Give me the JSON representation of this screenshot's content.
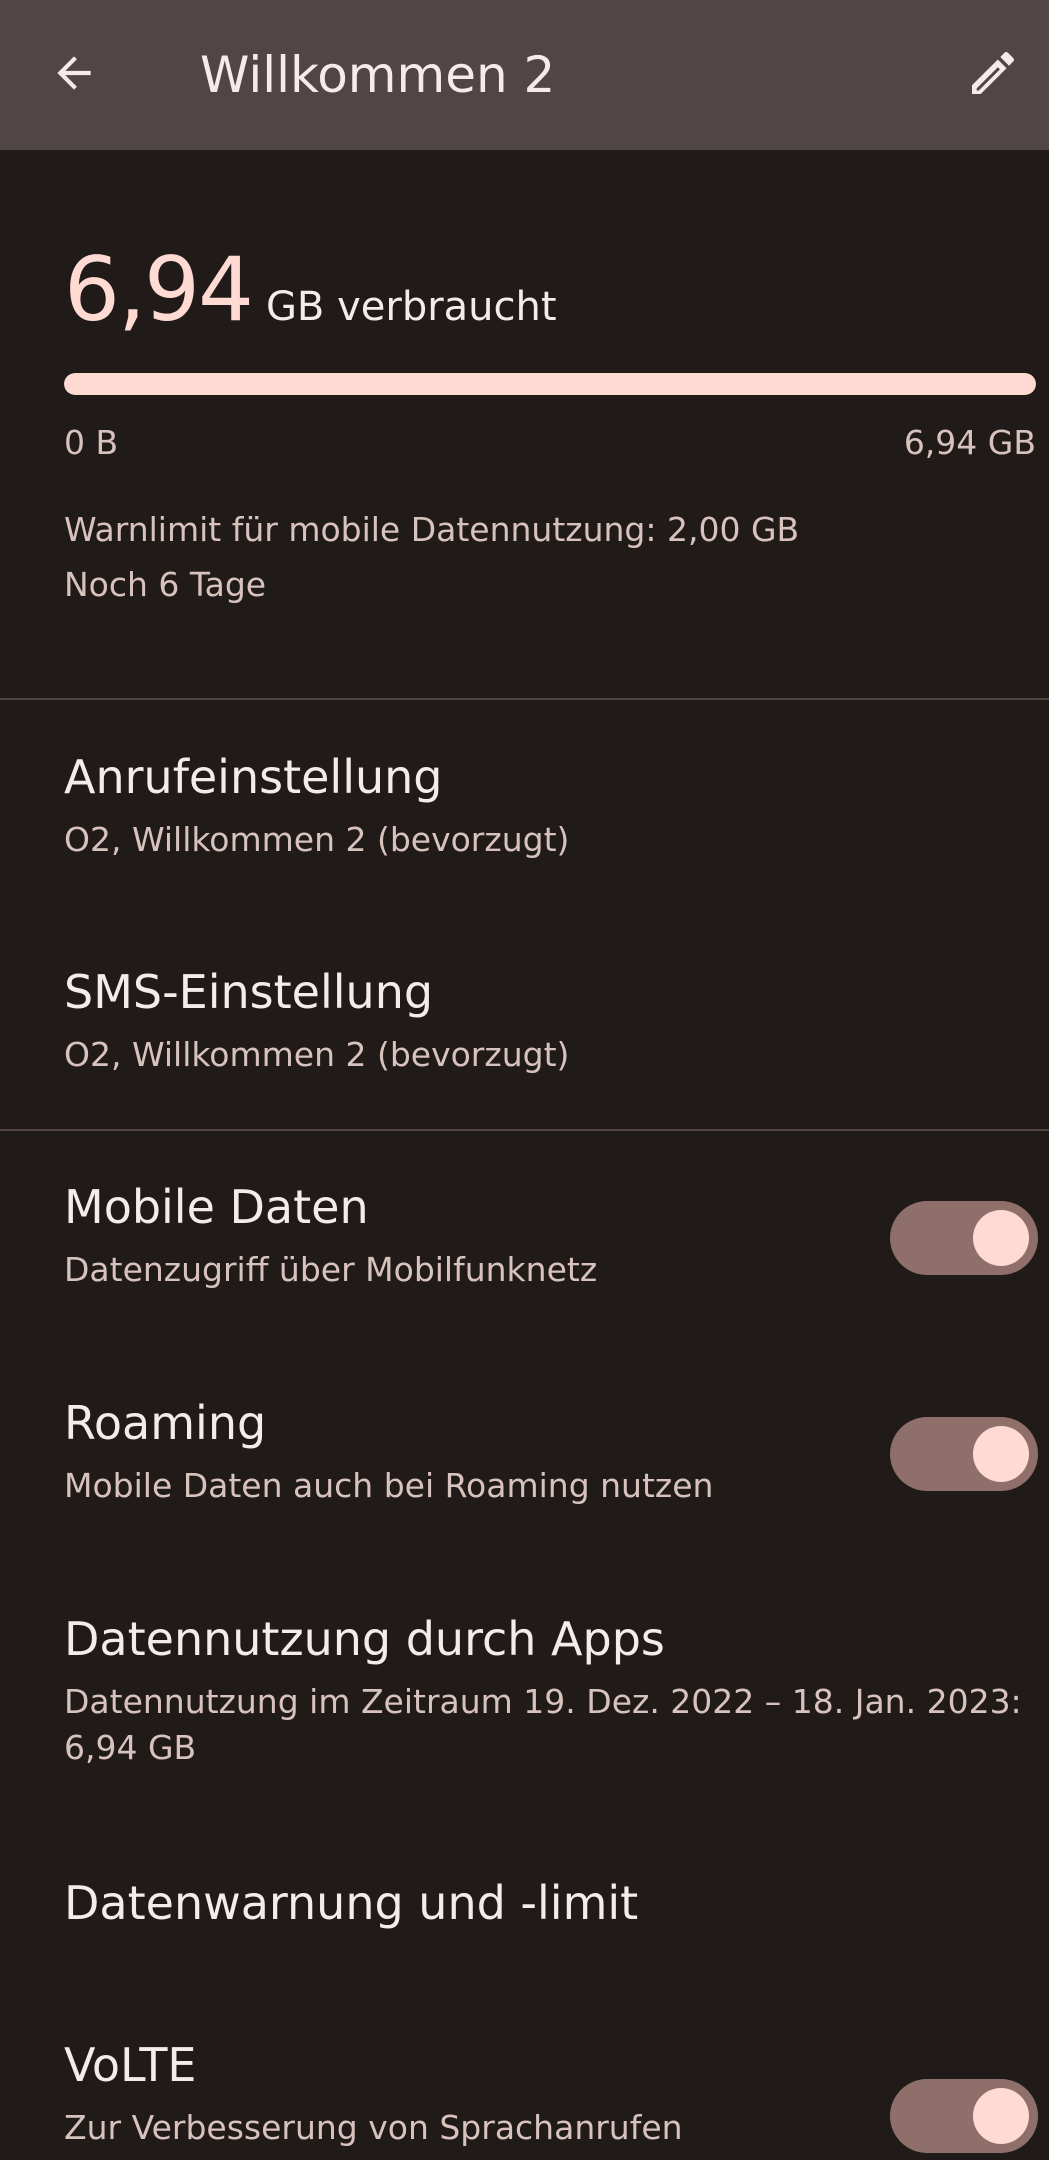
{
  "appbar": {
    "title": "Willkommen 2",
    "back_icon": "arrow-back-icon",
    "edit_icon": "pencil-icon"
  },
  "usage": {
    "amount": "6,94",
    "unit": "GB verbraucht",
    "progress_fraction": 1.0,
    "range_min": "0 B",
    "range_max": "6,94 GB",
    "warning": "Warnlimit für mobile Datennutzung: 2,00 GB",
    "days_left": "Noch 6 Tage"
  },
  "calls": {
    "title": "Anrufeinstellung",
    "subtitle": "O2, Willkommen 2 (bevorzugt)"
  },
  "sms": {
    "title": "SMS-Einstellung",
    "subtitle": "O2, Willkommen 2 (bevorzugt)"
  },
  "mobile_data": {
    "title": "Mobile Daten",
    "subtitle": "Datenzugriff über Mobilfunknetz",
    "enabled": true
  },
  "roaming": {
    "title": "Roaming",
    "subtitle": "Mobile Daten auch bei Roaming nutzen",
    "enabled": true
  },
  "app_usage": {
    "title": "Datennutzung durch Apps",
    "subtitle": "Datennutzung im Zeitraum 19. Dez. 2022 – 18. Jan. 2023: 6,94 GB"
  },
  "data_warning": {
    "title": "Datenwarnung und -limit"
  },
  "volte": {
    "title": "VoLTE",
    "subtitle": "Zur Verbesserung von Sprachanrufen",
    "enabled": true
  },
  "colors": {
    "background": "#201a19",
    "appbar": "#4f4645",
    "accent": "#ffdad3",
    "switch_track": "#8f6f69"
  }
}
